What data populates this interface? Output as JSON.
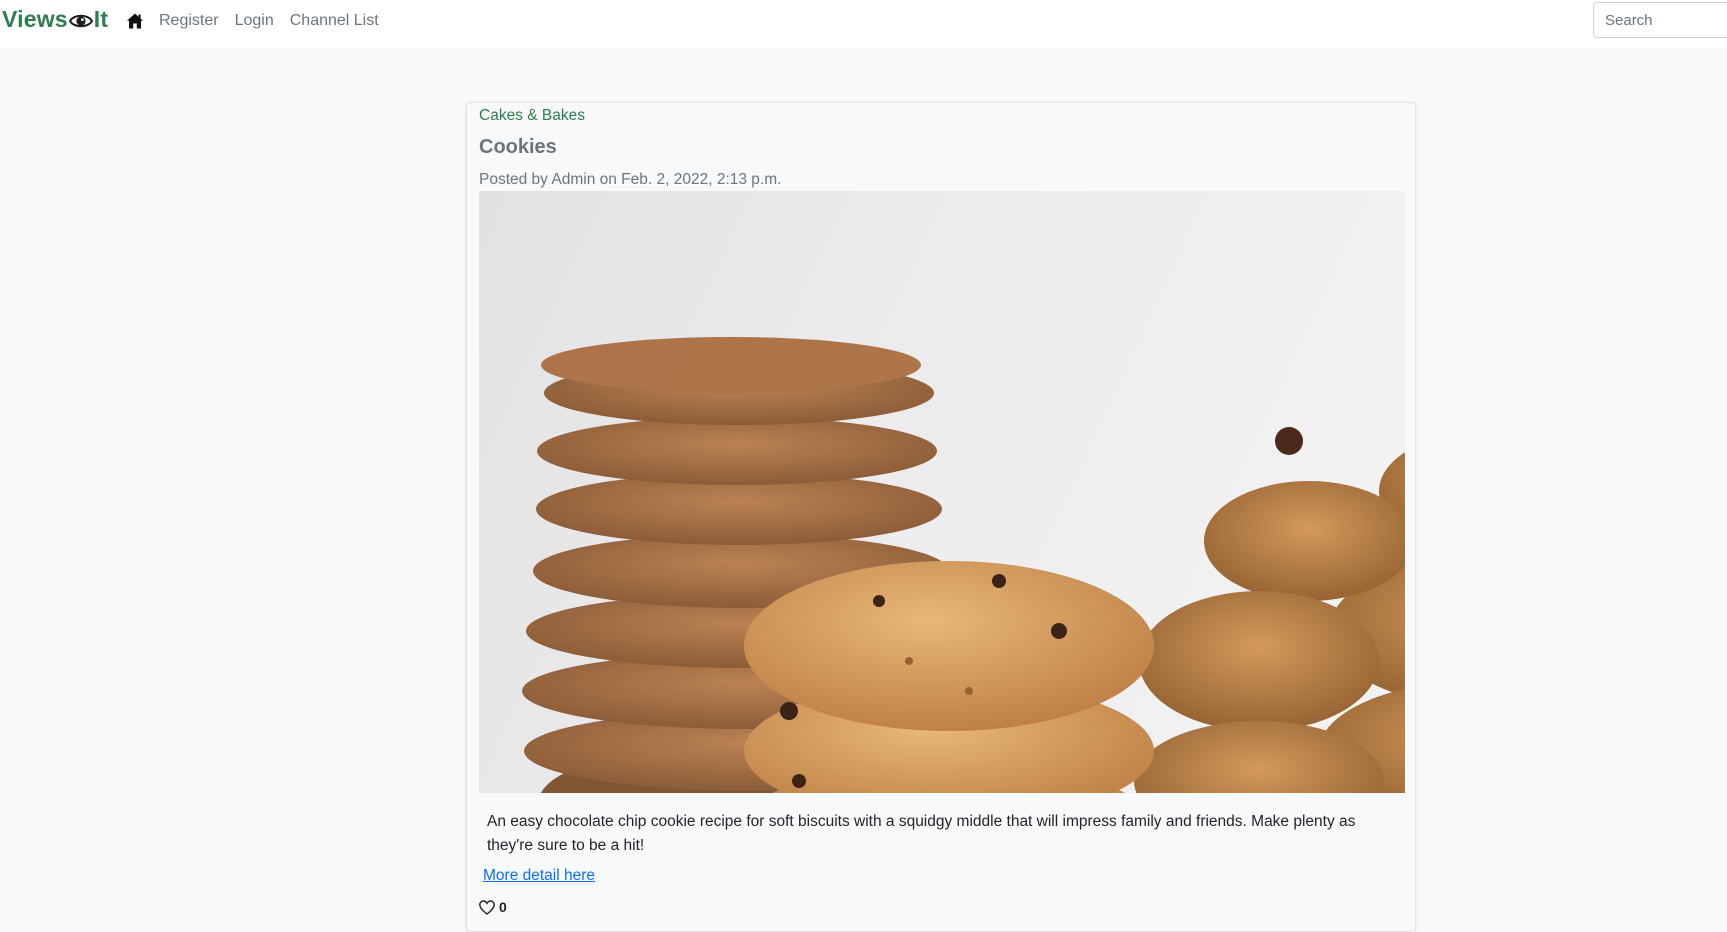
{
  "brand": {
    "text_before": "Views",
    "text_after": "It",
    "color": "#2e7d4f"
  },
  "nav": {
    "home_icon": "home-icon",
    "links": [
      "Register",
      "Login",
      "Channel List"
    ]
  },
  "search": {
    "placeholder": "Search",
    "value": ""
  },
  "post": {
    "channel": "Cakes & Bakes",
    "title": "Cookies",
    "meta": "Posted by Admin on Feb. 2, 2022, 2:13 p.m.",
    "image_subject": "stacks of cookies",
    "description": "An easy chocolate chip cookie recipe for soft biscuits with a squidgy middle that will impress family and friends. Make plenty as they're sure to be a hit!",
    "more_link": "More detail here",
    "like_icon": "heart-icon",
    "like_count": "0"
  },
  "colors": {
    "accent": "#2e7d4f",
    "link": "#0d6efd",
    "muted": "#6c757d",
    "background": "#f8f9fa"
  }
}
